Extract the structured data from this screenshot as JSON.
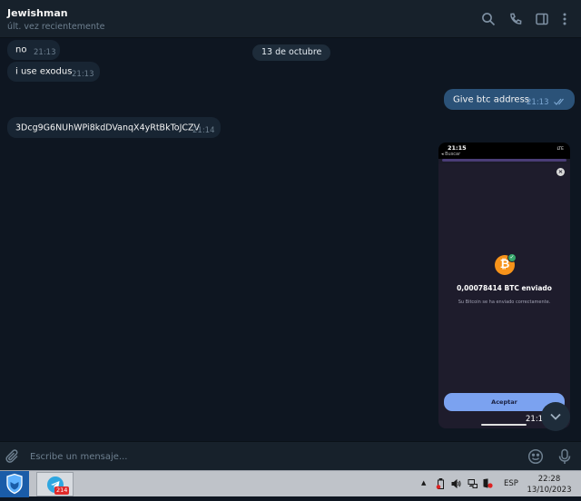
{
  "header": {
    "chat_name": "Jewishman",
    "status": "últ. vez recientemente",
    "icons": [
      "search-icon",
      "phone-icon",
      "sidebar-toggle-icon",
      "more-vertical-icon"
    ]
  },
  "date_separator": "13 de octubre",
  "messages": [
    {
      "direction": "in",
      "text": "no",
      "time": "21:13"
    },
    {
      "direction": "in",
      "text": "i use exodus",
      "time": "21:13"
    },
    {
      "direction": "out",
      "text": "Give btc address",
      "time": "21:13",
      "read": true
    },
    {
      "direction": "in",
      "text": "3Dcg9G6NUhWPi8kdDVanqX4yRtBkToJCZV",
      "time": "21:14"
    }
  ],
  "photo_message": {
    "time": "21:1",
    "screenshot": {
      "status_time": "21:15",
      "back_label": "◂ Buscar",
      "network": "LTE",
      "amount_text": "0,00078414 BTC enviado",
      "subtitle": "Su Bitcoin se ha enviado correctamente.",
      "button_label": "Aceptar",
      "coin_symbol": "₿",
      "accent_color": "#f7931a"
    }
  },
  "composer": {
    "placeholder": "Escribe un mensaje..."
  },
  "taskbar": {
    "telegram_badge": "214",
    "language": "ESP",
    "clock_time": "22:28",
    "clock_date": "13/10/2023"
  },
  "colors": {
    "background": "#0e1621",
    "header": "#17212b",
    "incoming_bubble": "#182533",
    "outgoing_bubble": "#2b5278",
    "taskbar": "#bfc3c9"
  }
}
